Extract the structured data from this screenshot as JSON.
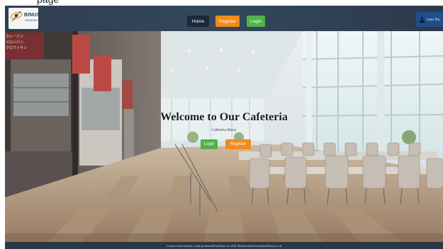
{
  "caption": "page",
  "brand": {
    "name": "BINUS",
    "subtitle": "UNIVERSITY"
  },
  "nav": {
    "home": "Home",
    "register": "Register",
    "login": "Login"
  },
  "user": {
    "label": "User Na"
  },
  "hero": {
    "title": "Welcome to Our Cafeteria",
    "subtitle": "Cafeteria Binus",
    "login": "Login",
    "register": "Register",
    "sign_lines": [
      "カレーパン",
      "メロンパン",
      "クロワッサン"
    ]
  },
  "footer": {
    "contact": "Contact Information: rizky.pratama001@binus.ac.id & Muhammad.fernando@binus.ac.id"
  },
  "colors": {
    "navbar": "#2f3e4f",
    "home_button": "#1b2a3b",
    "register_button": "#f28b1c",
    "login_button": "#4db34a",
    "user_button": "#1f4e8a",
    "footer": "#2c3744"
  }
}
